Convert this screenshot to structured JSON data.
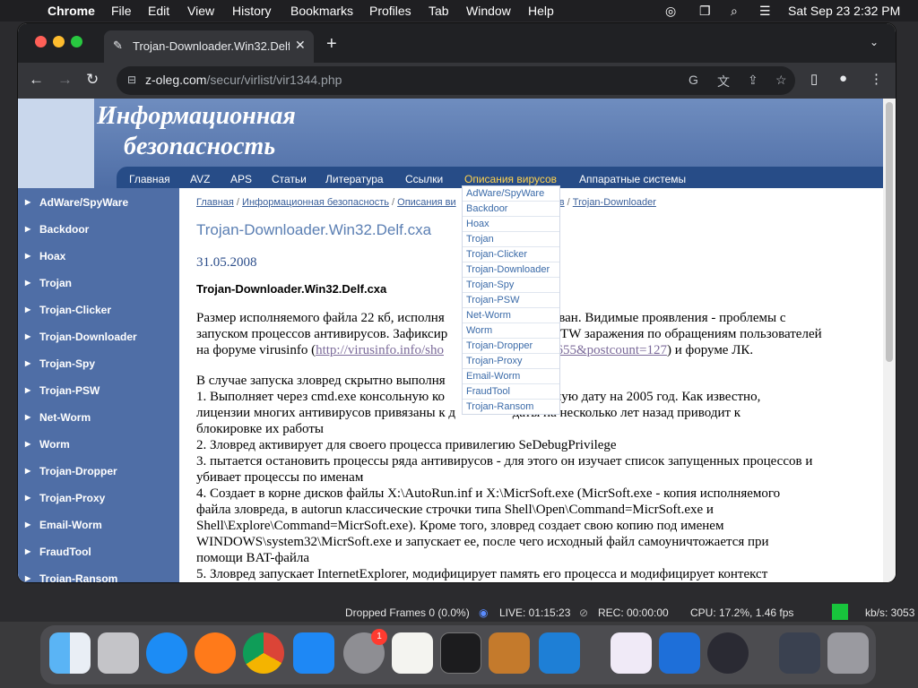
{
  "menubar": {
    "app": "Chrome",
    "items": [
      "File",
      "Edit",
      "View",
      "History",
      "Bookmarks",
      "Profiles",
      "Tab",
      "Window",
      "Help"
    ],
    "datetime": "Sat Sep 23  2:32 PM"
  },
  "tab": {
    "title": "Trojan-Downloader.Win32.Delf.",
    "close": "✕"
  },
  "address": {
    "host": "z-oleg.com",
    "path": "/secur/virlist/vir1344.php"
  },
  "site": {
    "title_line1": "Информационная",
    "title_line2": "безопасность",
    "nav": [
      "Главная",
      "AVZ",
      "APS",
      "Статьи",
      "Литература",
      "Ссылки",
      "Описания вирусов",
      "Аппаратные системы"
    ],
    "active_nav": "Описания вирусов",
    "sidebar": [
      "AdWare/SpyWare",
      "Backdoor",
      "Hoax",
      "Trojan",
      "Trojan-Clicker",
      "Trojan-Downloader",
      "Trojan-Spy",
      "Trojan-PSW",
      "Net-Worm",
      "Worm",
      "Trojan-Dropper",
      "Trojan-Proxy",
      "Email-Worm",
      "FraudTool",
      "Trojan-Ransom"
    ],
    "dropdown": [
      "AdWare/SpyWare",
      "Backdoor",
      "Hoax",
      "Trojan",
      "Trojan-Clicker",
      "Trojan-Downloader",
      "Trojan-Spy",
      "Trojan-PSW",
      "Net-Worm",
      "Worm",
      "Trojan-Dropper",
      "Trojan-Proxy",
      "Email-Worm",
      "FraudTool",
      "Trojan-Ransom"
    ],
    "breadcrumbs": [
      "Главная",
      "Информационная безопасность",
      "Описания ви",
      "русов",
      "Trojan-Downloader"
    ],
    "heading": "Trojan-Downloader.Win32.Delf.cxa",
    "date": "31.05.2008",
    "subheading": "Trojan-Downloader.Win32.Delf.cxa",
    "p1_a": "Размер исполняемого файла 22 кб, исполня",
    "p1_b": "ован. Видимые проявления - проблемы с",
    "p1_c": "запуском процессов антивирусов. Зафиксир",
    "p1_d": "в ITW заражения по обращениям пользователей",
    "p1_e": "на форуме virusinfo (",
    "p1_link": "http://virusinfo.info/sho",
    "p1_link2": "4655&postcount=127",
    "p1_f": ") и форуме ЛК.",
    "p2": [
      "В случае запуска зловред скрытно выполня                  перации:",
      "1. Выполняет через cmd.exe консольную ко                  я системную дату на 2005 год. Как известно,",
      "лицензии многих антивирусов привязаны к д                 даты на несколько лет назад приводит к",
      "блокировке их работы",
      "2. Зловред активирует для своего процесса привилегию SeDebugPrivilege",
      "3. пытается остановить процессы ряда антивирусов - для этого он изучает список запущенных процессов и",
      "убивает процессы по именам",
      "4. Создает в корне дисков файлы X:\\AutoRun.inf и X:\\MicrSoft.exe (MicrSoft.exe - копия исполняемого",
      "файла зловреда, в autorun классические строчки типа Shell\\Open\\Command=MicrSoft.exe и",
      "Shell\\Explore\\Command=MicrSoft.exe). Кроме того, зловред создает свою копию под именем",
      "WINDOWS\\system32\\MicrSoft.exe и запускает ее, после чего исходный файл самоуничтожается при",
      "помощи BAT-файла",
      "5. Зловред запускает InternetExplorer, модифицирует память его процесса и модифицирует контекст"
    ]
  },
  "statusbar": {
    "dropped": "Dropped Frames 0 (0.0%)",
    "live": "LIVE: 01:15:23",
    "rec": "REC: 00:00:00",
    "cpu": "CPU: 17.2%, 1.46 fps",
    "kbs": "kb/s: 3053"
  },
  "dock": {
    "badge": "1",
    "icons": [
      "finder-icon",
      "launchpad-icon",
      "safari-icon",
      "firefox-icon",
      "chrome-icon",
      "app-store-icon",
      "system-settings-icon",
      "textedit-icon",
      "terminal-icon",
      "garageband-icon",
      "vscode-icon",
      "visual-studio-icon",
      "cloud-icon",
      "obs-icon",
      "screen-icon",
      "trash-icon"
    ]
  },
  "colors": {
    "header": "#4f6ea6",
    "nav": "#274c87",
    "active_nav": "#ffd24d",
    "link": "#3a6aa8"
  }
}
